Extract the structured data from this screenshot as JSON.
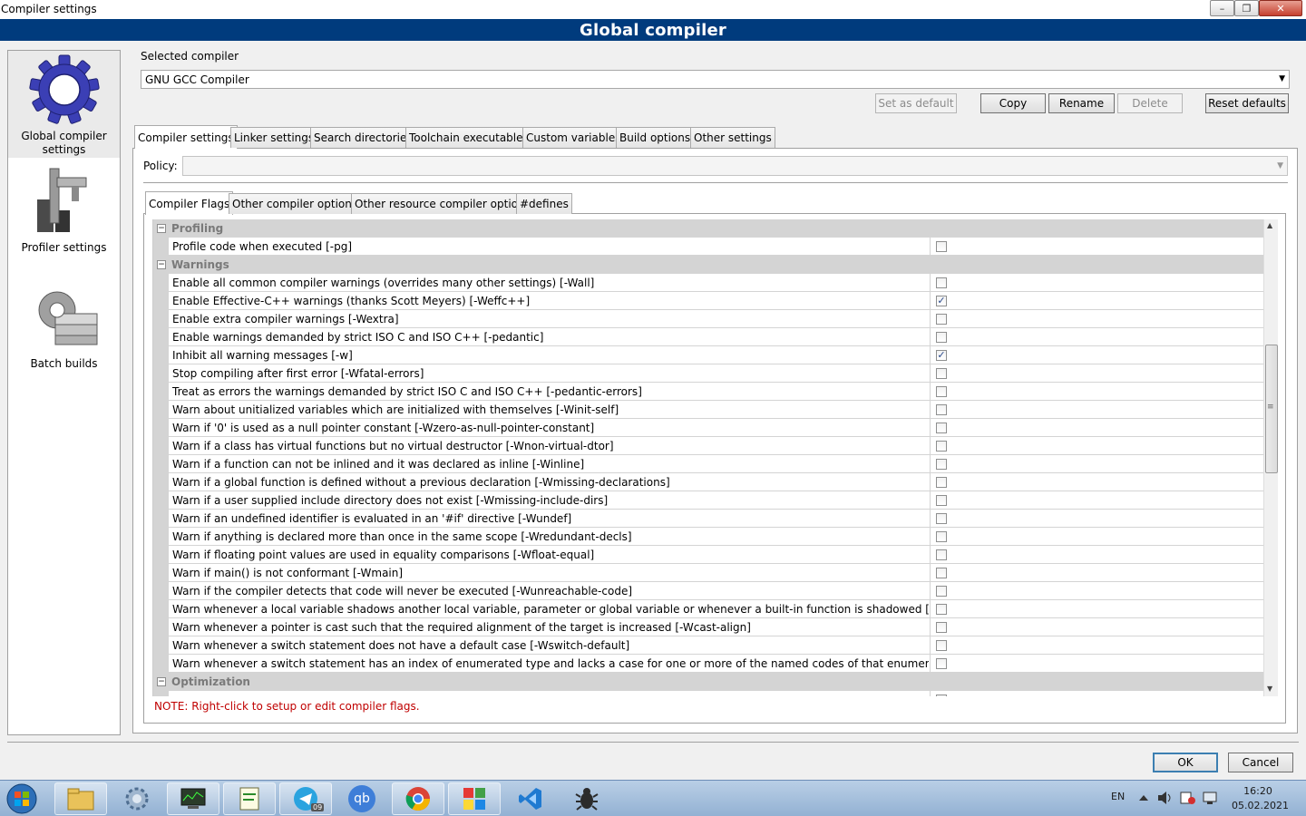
{
  "window": {
    "title": "Compiler settings",
    "header": "Global compiler"
  },
  "titlebar_buttons": {
    "minimize": "–",
    "maximize": "❐",
    "close": "✕"
  },
  "sidebar": {
    "items": [
      {
        "label": "Global compiler settings",
        "icon": "gear-icon",
        "selected": true
      },
      {
        "label": "Profiler settings",
        "icon": "caliper-icon"
      },
      {
        "label": "Batch builds",
        "icon": "gears-stack-icon"
      }
    ]
  },
  "compiler": {
    "label": "Selected compiler",
    "value": "GNU GCC Compiler",
    "buttons": {
      "set_default": "Set as default",
      "copy": "Copy",
      "rename": "Rename",
      "delete": "Delete",
      "reset_defaults": "Reset defaults"
    }
  },
  "tabs": [
    "Compiler settings",
    "Linker settings",
    "Search directories",
    "Toolchain executables",
    "Custom variables",
    "Build options",
    "Other settings"
  ],
  "policy": {
    "label": "Policy:",
    "value": ""
  },
  "subtabs": [
    "Compiler Flags",
    "Other compiler options",
    "Other resource compiler options",
    "#defines"
  ],
  "flags": {
    "categories": [
      {
        "name": "Profiling",
        "items": [
          {
            "label": "Profile code when executed  [-pg]",
            "checked": false
          }
        ]
      },
      {
        "name": "Warnings",
        "items": [
          {
            "label": "Enable all common compiler warnings (overrides many other settings)  [-Wall]",
            "checked": false
          },
          {
            "label": "Enable Effective-C++ warnings (thanks Scott Meyers)  [-Weffc++]",
            "checked": true
          },
          {
            "label": "Enable extra compiler warnings  [-Wextra]",
            "checked": false
          },
          {
            "label": "Enable warnings demanded by strict ISO C and ISO C++  [-pedantic]",
            "checked": false
          },
          {
            "label": "Inhibit all warning messages  [-w]",
            "checked": true
          },
          {
            "label": "Stop compiling after first error  [-Wfatal-errors]",
            "checked": false
          },
          {
            "label": "Treat as errors the warnings demanded by strict ISO C and ISO C++  [-pedantic-errors]",
            "checked": false
          },
          {
            "label": "Warn about unitialized variables which are initialized with themselves  [-Winit-self]",
            "checked": false
          },
          {
            "label": "Warn if '0' is used as a null pointer constant  [-Wzero-as-null-pointer-constant]",
            "checked": false
          },
          {
            "label": "Warn if a class has virtual functions but no virtual destructor  [-Wnon-virtual-dtor]",
            "checked": false
          },
          {
            "label": "Warn if a function can not be inlined and it was declared as inline  [-Winline]",
            "checked": false
          },
          {
            "label": "Warn if a global function is defined without a previous declaration  [-Wmissing-declarations]",
            "checked": false
          },
          {
            "label": "Warn if a user supplied include directory does not exist  [-Wmissing-include-dirs]",
            "checked": false
          },
          {
            "label": "Warn if an undefined identifier is evaluated in an '#if' directive  [-Wundef]",
            "checked": false
          },
          {
            "label": "Warn if anything is declared more than once in the same scope  [-Wredundant-decls]",
            "checked": false
          },
          {
            "label": "Warn if floating point values are used in equality comparisons  [-Wfloat-equal]",
            "checked": false
          },
          {
            "label": "Warn if main() is not conformant  [-Wmain]",
            "checked": false
          },
          {
            "label": "Warn if the compiler detects that code will never be executed  [-Wunreachable-code]",
            "checked": false
          },
          {
            "label": "Warn whenever a local variable shadows another local variable, parameter or global variable or whenever a built-in function is shadowed  [-Wshadow]",
            "checked": false
          },
          {
            "label": "Warn whenever a pointer is cast such that the required alignment of the target is increased  [-Wcast-align]",
            "checked": false
          },
          {
            "label": "Warn whenever a switch statement does not have a default case  [-Wswitch-default]",
            "checked": false
          },
          {
            "label": "Warn whenever a switch statement has an index of enumerated type and lacks a case for one or more of the named codes of that enumeration  [-Wswitch-enum]",
            "checked": false
          }
        ]
      },
      {
        "name": "Optimization",
        "items": []
      }
    ]
  },
  "note": "NOTE: Right-click to setup or edit compiler flags.",
  "dialog_buttons": {
    "ok": "OK",
    "cancel": "Cancel"
  },
  "taskbar": {
    "apps": [
      "start-orb-icon",
      "file-explorer-icon",
      "settings-gear-icon",
      "system-monitor-icon",
      "text-editor-icon",
      "telegram-icon",
      "qbittorrent-icon",
      "chrome-icon",
      "codeblocks-icon",
      "vscode-icon",
      "bug-icon"
    ],
    "telegram_badge": "09",
    "qbittorrent_text": "qb",
    "language": "EN",
    "time": "16:20",
    "date": "05.02.2021"
  },
  "colors": {
    "header_bg": "#003b7d",
    "note": "#c00000",
    "category_bg": "#d4d4d4"
  }
}
